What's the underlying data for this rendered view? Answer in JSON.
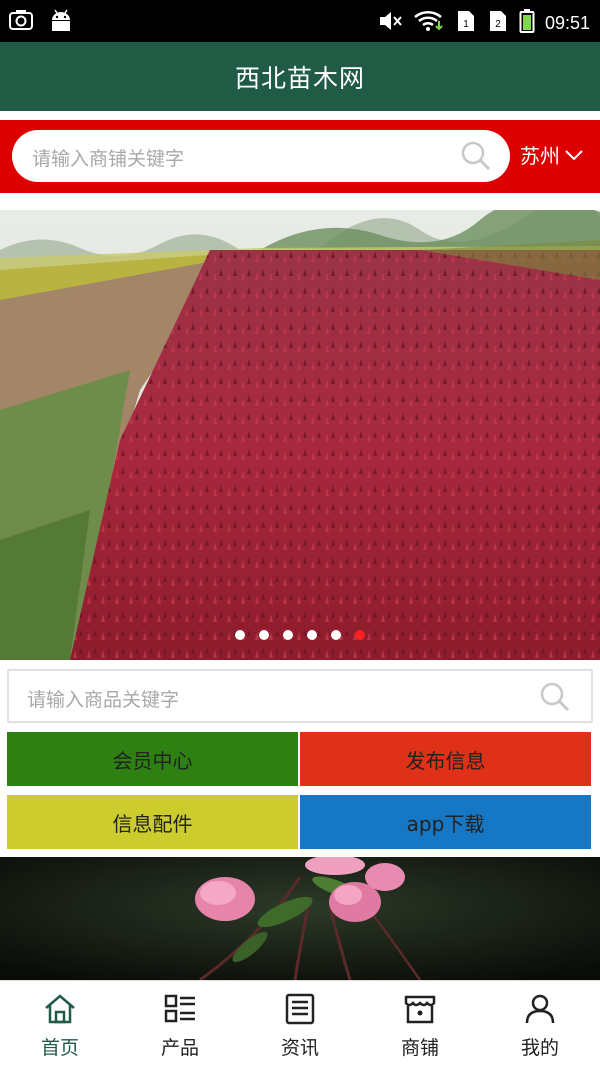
{
  "status_bar": {
    "time": "09:51",
    "icons": [
      "screenshot-icon",
      "android-icon",
      "mute-icon",
      "wifi-icon",
      "sim1-icon",
      "sim2-icon",
      "battery-icon"
    ]
  },
  "header": {
    "title": "西北苗木网"
  },
  "search": {
    "placeholder": "请输入商铺关键字",
    "city": "苏州"
  },
  "banner": {
    "slide_count": 6,
    "active_index": 5
  },
  "product_search": {
    "placeholder": "请输入商品关键字"
  },
  "quick_links": [
    {
      "label": "会员中心",
      "color": "#2e8012"
    },
    {
      "label": "发布信息",
      "color": "#df3018"
    },
    {
      "label": "信息配件",
      "color": "#cccd2c"
    },
    {
      "label": "app下载",
      "color": "#1678c4"
    }
  ],
  "tabs": [
    {
      "label": "首页",
      "icon": "home-icon",
      "active": true
    },
    {
      "label": "产品",
      "icon": "grid-list-icon",
      "active": false
    },
    {
      "label": "资讯",
      "icon": "news-icon",
      "active": false
    },
    {
      "label": "商铺",
      "icon": "store-icon",
      "active": false
    },
    {
      "label": "我的",
      "icon": "user-icon",
      "active": false
    }
  ],
  "colors": {
    "header": "#1f5b45",
    "search_bar": "#dd0000",
    "active_tab": "#1f5b45"
  }
}
